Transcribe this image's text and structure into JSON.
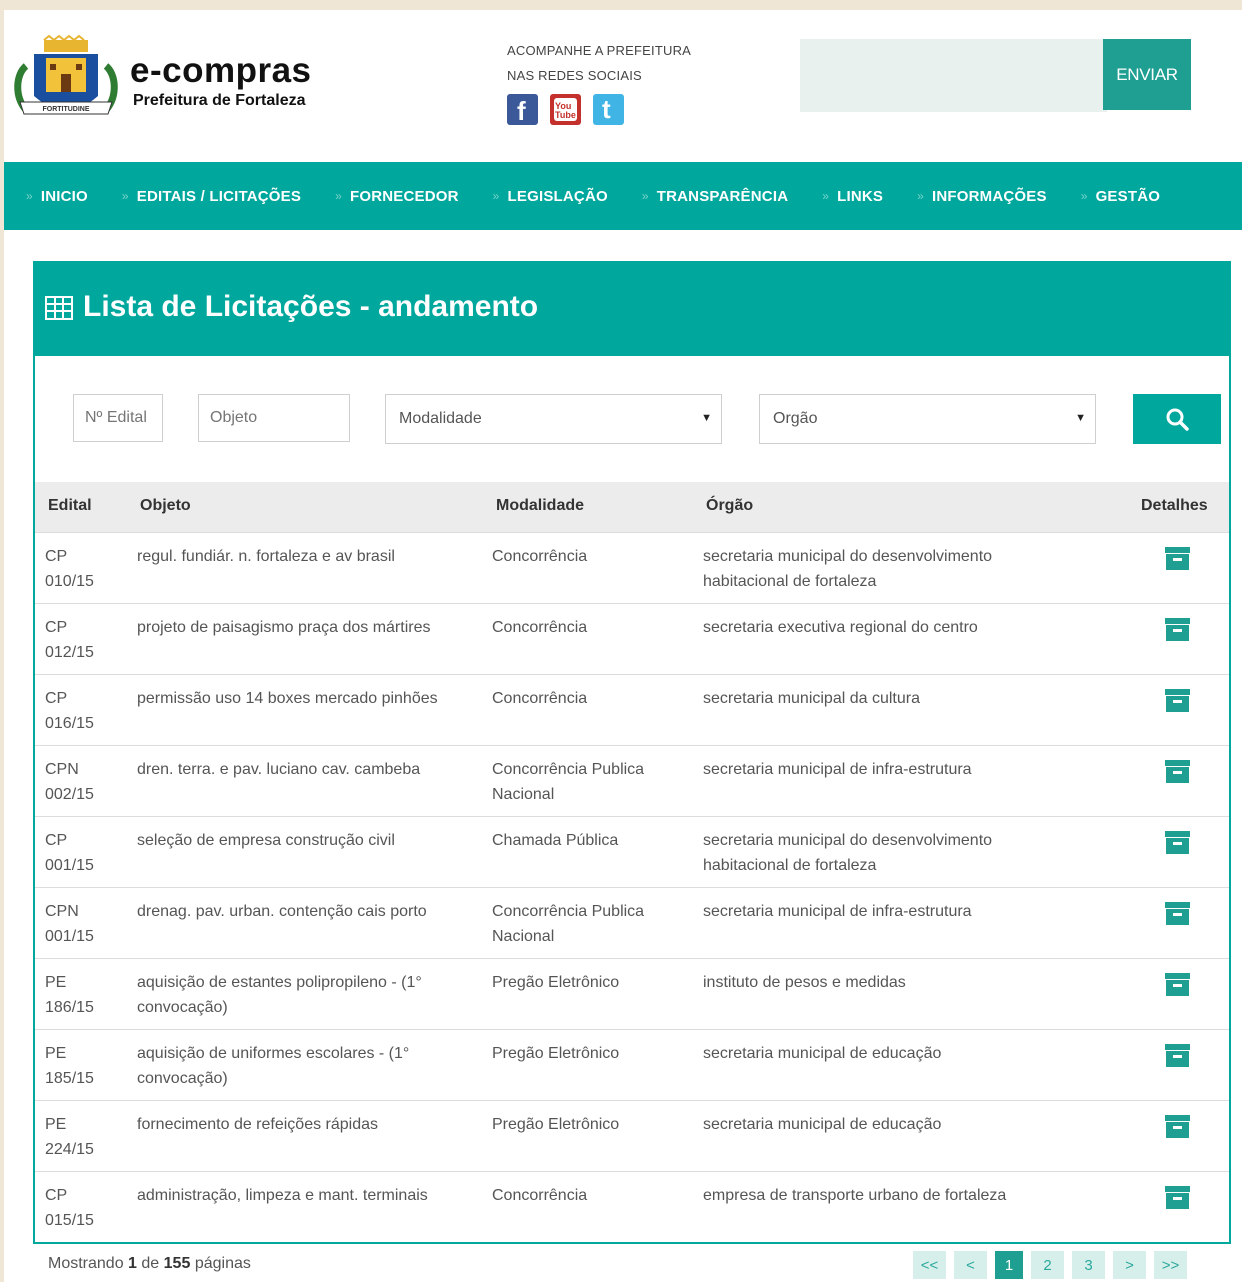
{
  "header": {
    "brand": "e-compras",
    "brand_sub": "Prefeitura de Fortaleza",
    "emblem_text": "FORTITUDINE",
    "social_line1": "ACOMPANHE A PREFEITURA",
    "social_line2": "NAS REDES SOCIAIS",
    "social_icons": [
      "facebook-icon",
      "youtube-icon",
      "twitter-icon"
    ],
    "youtube_text": "You Tube",
    "search_value": "",
    "send_label": "ENVIAR"
  },
  "nav": {
    "items": [
      "INICIO",
      "EDITAIS / LICITAÇÕES",
      "FORNECEDOR",
      "LEGISLAÇÃO",
      "TRANSPARÊNCIA",
      "LINKS",
      "INFORMAÇÕES",
      "GESTÃO"
    ]
  },
  "panel": {
    "title": "Lista de Licitações - andamento",
    "filters": {
      "edital_placeholder": "Nº Edital",
      "objeto_placeholder": "Objeto",
      "modalidade_selected": "Modalidade",
      "orgao_selected": "Orgão"
    },
    "columns": [
      "Edital",
      "Objeto",
      "Modalidade",
      "Órgão",
      "Detalhes"
    ],
    "rows": [
      {
        "edital": "CP 010/15",
        "objeto": "regul. fundiár. n. fortaleza e av brasil",
        "modalidade": "Concorrência",
        "orgao": "secretaria municipal do desenvolvimento habitacional de fortaleza"
      },
      {
        "edital": "CP 012/15",
        "objeto": "projeto de paisagismo praça dos mártires",
        "modalidade": "Concorrência",
        "orgao": "secretaria executiva regional do centro"
      },
      {
        "edital": "CP 016/15",
        "objeto": "permissão uso 14 boxes mercado pinhões",
        "modalidade": "Concorrência",
        "orgao": "secretaria municipal da cultura"
      },
      {
        "edital": "CPN 002/15",
        "objeto": "dren. terra. e pav. luciano cav. cambeba",
        "modalidade": "Concorrência Publica Nacional",
        "orgao": "secretaria municipal de infra-estrutura"
      },
      {
        "edital": "CP 001/15",
        "objeto": "seleção de empresa construção civil",
        "modalidade": "Chamada Pública",
        "orgao": "secretaria municipal do desenvolvimento habitacional de fortaleza"
      },
      {
        "edital": "CPN 001/15",
        "objeto": "drenag. pav. urban. contenção cais porto",
        "modalidade": "Concorrência Publica Nacional",
        "orgao": "secretaria municipal de infra-estrutura"
      },
      {
        "edital": "PE 186/15",
        "objeto": "aquisição de estantes polipropileno - (1° convocação)",
        "modalidade": "Pregão Eletrônico",
        "orgao": "instituto de pesos e medidas"
      },
      {
        "edital": "PE 185/15",
        "objeto": "aquisição de uniformes escolares - (1° convocação)",
        "modalidade": "Pregão Eletrônico",
        "orgao": "secretaria municipal de educação"
      },
      {
        "edital": "PE 224/15",
        "objeto": "fornecimento de refeições rápidas",
        "modalidade": "Pregão Eletrônico",
        "orgao": "secretaria municipal de educação"
      },
      {
        "edital": "CP 015/15",
        "objeto": "administração, limpeza e mant. terminais",
        "modalidade": "Concorrência",
        "orgao": "empresa de transporte urbano de fortaleza"
      }
    ]
  },
  "footer": {
    "showing_prefix": "Mostrando",
    "current_page": "1",
    "of_label": "de",
    "total_pages": "155",
    "pages_label": "páginas",
    "pager": [
      "<<",
      "<",
      "1",
      "2",
      "3",
      ">",
      ">>"
    ],
    "active_page": "1"
  },
  "colors": {
    "accent": "#00a79d",
    "accent_dark": "#1f9e92",
    "page_bg": "#efe6d6"
  }
}
